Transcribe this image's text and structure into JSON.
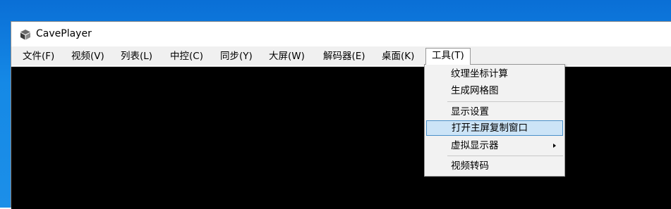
{
  "window": {
    "title": "CavePlayer",
    "icon": "cube-icon"
  },
  "menubar": {
    "items": [
      {
        "label": "文件(F)"
      },
      {
        "label": "视频(V)"
      },
      {
        "label": "列表(L)"
      },
      {
        "label": "中控(C)"
      },
      {
        "label": "同步(Y)"
      },
      {
        "label": "大屏(W)"
      },
      {
        "label": "解码器(E)"
      },
      {
        "label": "桌面(K)"
      },
      {
        "label": "工具(T)",
        "open": true
      }
    ]
  },
  "tools_menu": {
    "items": [
      {
        "label": "纹理坐标计算"
      },
      {
        "label": "生成网格图"
      },
      {
        "label": "显示设置"
      },
      {
        "label": "打开主屏复制窗口",
        "highlighted": true
      },
      {
        "label": "虚拟显示器",
        "has_submenu": true
      },
      {
        "label": "视频转码"
      }
    ]
  },
  "colors": {
    "desktop": "#1589e6",
    "video_background": "#000000",
    "highlight": "#cce4f7",
    "highlight_border": "#4a90c9"
  }
}
